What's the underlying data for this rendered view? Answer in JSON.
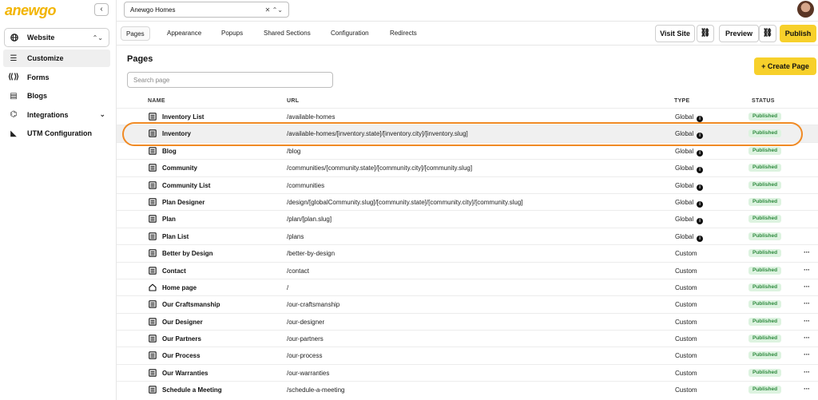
{
  "brand": {
    "logo_text": "anewgo",
    "accent": "#f7d02b",
    "highlight": "#f08a24"
  },
  "sidebar": {
    "collapse_icon": "chevron-left-icon",
    "collapse_label": "‹",
    "site_select": {
      "value": "Website",
      "icon": "globe-icon"
    },
    "items": [
      {
        "label": "Customize",
        "icon": "sliders-icon",
        "active": true
      },
      {
        "label": "Forms",
        "icon": "form-icon"
      },
      {
        "label": "Blogs",
        "icon": "newspaper-icon"
      },
      {
        "label": "Integrations",
        "icon": "plug-icon",
        "expandable": true
      },
      {
        "label": "UTM Configuration",
        "icon": "tag-icon"
      }
    ]
  },
  "topbar": {
    "project": "Anewgo Homes",
    "project_controls": "✕ ⌃⌄"
  },
  "tabs": [
    {
      "label": "Pages",
      "active": true
    },
    {
      "label": "Appearance"
    },
    {
      "label": "Popups"
    },
    {
      "label": "Shared Sections"
    },
    {
      "label": "Configuration"
    },
    {
      "label": "Redirects"
    }
  ],
  "actions": {
    "visit_site": "Visit Site",
    "preview": "Preview",
    "publish": "Publish",
    "link_icon": "⛓"
  },
  "main": {
    "title": "Pages",
    "create_label": "+ Create Page",
    "search_placeholder": "Search page",
    "columns": {
      "name": "NAME",
      "url": "URL",
      "type": "TYPE",
      "status": "STATUS"
    },
    "rows": [
      {
        "name": "Inventory List",
        "url": "/available-homes",
        "type": "Global",
        "status": "Published",
        "icon": "page-icon",
        "info": true
      },
      {
        "name": "Inventory",
        "url": "/available-homes/[inventory.state]/[inventory.city]/[inventory.slug]",
        "type": "Global",
        "status": "Published",
        "icon": "page-icon",
        "info": true,
        "highlight": true
      },
      {
        "name": "Blog",
        "url": "/blog",
        "type": "Global",
        "status": "Published",
        "icon": "page-icon",
        "info": true
      },
      {
        "name": "Community",
        "url": "/communities/[community.state]/[community.city]/[community.slug]",
        "type": "Global",
        "status": "Published",
        "icon": "page-icon",
        "info": true
      },
      {
        "name": "Community List",
        "url": "/communities",
        "type": "Global",
        "status": "Published",
        "icon": "page-icon",
        "info": true
      },
      {
        "name": "Plan Designer",
        "url": "/design/[globalCommunity.slug]/[community.state]/[community.city]/[community.slug]",
        "type": "Global",
        "status": "Published",
        "icon": "page-icon",
        "info": true
      },
      {
        "name": "Plan",
        "url": "/plan/[plan.slug]",
        "type": "Global",
        "status": "Published",
        "icon": "page-icon",
        "info": true
      },
      {
        "name": "Plan List",
        "url": "/plans",
        "type": "Global",
        "status": "Published",
        "icon": "page-icon",
        "info": true
      },
      {
        "name": "Better by Design",
        "url": "/better-by-design",
        "type": "Custom",
        "status": "Published",
        "icon": "page-icon",
        "more": true
      },
      {
        "name": "Contact",
        "url": "/contact",
        "type": "Custom",
        "status": "Published",
        "icon": "page-icon",
        "more": true
      },
      {
        "name": "Home page",
        "url": "/",
        "type": "Custom",
        "status": "Published",
        "icon": "home-icon",
        "more": true
      },
      {
        "name": "Our Craftsmanship",
        "url": "/our-craftsmanship",
        "type": "Custom",
        "status": "Published",
        "icon": "page-icon",
        "more": true
      },
      {
        "name": "Our Designer",
        "url": "/our-designer",
        "type": "Custom",
        "status": "Published",
        "icon": "page-icon",
        "more": true
      },
      {
        "name": "Our Partners",
        "url": "/our-partners",
        "type": "Custom",
        "status": "Published",
        "icon": "page-icon",
        "more": true
      },
      {
        "name": "Our Process",
        "url": "/our-process",
        "type": "Custom",
        "status": "Published",
        "icon": "page-icon",
        "more": true
      },
      {
        "name": "Our Warranties",
        "url": "/our-warranties",
        "type": "Custom",
        "status": "Published",
        "icon": "page-icon",
        "more": true
      },
      {
        "name": "Schedule a Meeting",
        "url": "/schedule-a-meeting",
        "type": "Custom",
        "status": "Published",
        "icon": "page-icon",
        "more": true
      }
    ]
  }
}
